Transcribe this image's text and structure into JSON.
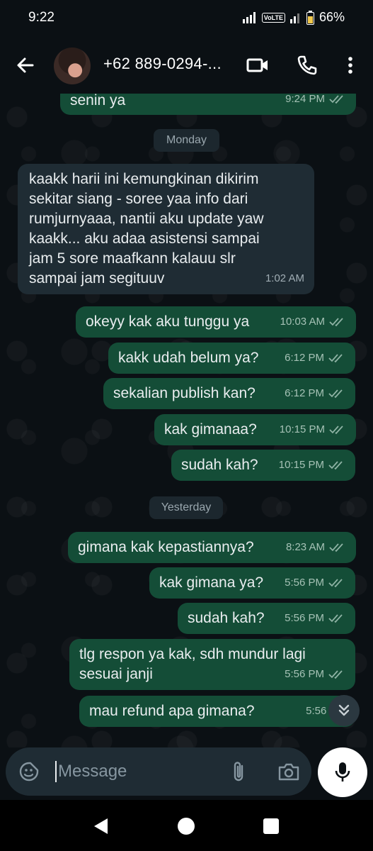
{
  "status_bar": {
    "time": "9:22",
    "network": "VoLTE",
    "battery": "66%"
  },
  "header": {
    "contact": "+62 889-0294-..."
  },
  "messages": [
    {
      "dir": "out",
      "text": "senin ya",
      "time": "9:24 PM"
    },
    {
      "type": "day",
      "label": "Monday"
    },
    {
      "dir": "in",
      "text": "kaakk harii ini kemungkinan dikirim\nsekitar siang - soree yaa info dari\nrumjurnyaaa, nantii aku update yaw\nkaakk... aku adaa asistensi sampai\njam 5 sore maafkann kalauu slr\nsampai jam segituuv",
      "time": "1:02 AM"
    },
    {
      "dir": "out",
      "text": "okeyy kak aku tunggu ya",
      "time": "10:03 AM"
    },
    {
      "dir": "out",
      "text": "kakk udah belum ya?",
      "time": "6:12 PM"
    },
    {
      "dir": "out",
      "text": "sekalian publish kan?",
      "time": "6:12 PM"
    },
    {
      "dir": "out",
      "text": "kak gimanaa?",
      "time": "10:15 PM"
    },
    {
      "dir": "out",
      "text": "sudah kah?",
      "time": "10:15 PM"
    },
    {
      "type": "day",
      "label": "Yesterday"
    },
    {
      "dir": "out",
      "text": "gimana kak kepastiannya?",
      "time": "8:23 AM"
    },
    {
      "dir": "out",
      "text": "kak gimana ya?",
      "time": "5:56 PM"
    },
    {
      "dir": "out",
      "text": "sudah kah?",
      "time": "5:56 PM"
    },
    {
      "dir": "out",
      "text": "tlg respon ya kak, sdh mundur lagi\nsesuai janji",
      "time": "5:56 PM"
    },
    {
      "dir": "out",
      "text": "mau refund apa gimana?",
      "time": "5:56 PM"
    }
  ],
  "composer": {
    "placeholder": "Message"
  },
  "colors": {
    "outgoing": "#144d37",
    "incoming": "#1f2c34",
    "background": "#0b1014",
    "tick": "#8fb3a5"
  }
}
